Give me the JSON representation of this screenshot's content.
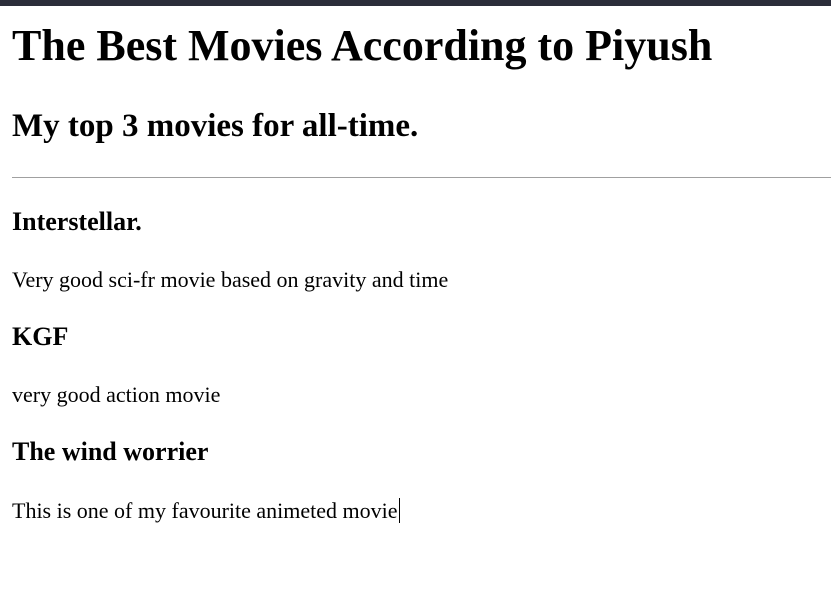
{
  "page": {
    "title": "The Best Movies According to Piyush",
    "subtitle": "My top 3 movies for all-time."
  },
  "movies": [
    {
      "title": "Interstellar.",
      "description": "Very good sci-fr movie based on gravity and time"
    },
    {
      "title": "KGF",
      "description": "very good action movie"
    },
    {
      "title": "The wind worrier",
      "description": "This is one of my favourite animeted movie"
    }
  ],
  "colors": {
    "top_bar": "#2b2d3a",
    "divider": "#a0a0a0",
    "text": "#000000",
    "background": "#ffffff"
  }
}
